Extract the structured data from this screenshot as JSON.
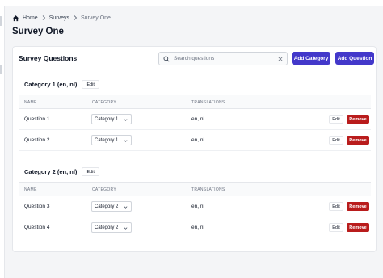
{
  "breadcrumb": {
    "home": "Home",
    "surveys": "Surveys",
    "current": "Survey One"
  },
  "page": {
    "title": "Survey One"
  },
  "card": {
    "title": "Survey Questions",
    "search_placeholder": "Search questions",
    "add_category_label": "Add Category",
    "add_question_label": "Add Question"
  },
  "columns": {
    "name": "NAME",
    "category": "CATEGORY",
    "translations": "TRANSLATIONS"
  },
  "actions": {
    "edit": "Edit",
    "remove": "Remove"
  },
  "categories": [
    {
      "title": "Category 1 (en, nl)",
      "edit_label": "Edit",
      "questions": [
        {
          "name": "Question 1",
          "category": "Category 1",
          "translations": "en, nl"
        },
        {
          "name": "Question 2",
          "category": "Category 1",
          "translations": "en, nl"
        }
      ]
    },
    {
      "title": "Category 2 (en, nl)",
      "edit_label": "Edit",
      "questions": [
        {
          "name": "Question 3",
          "category": "Category 2",
          "translations": "en, nl"
        },
        {
          "name": "Question 4",
          "category": "Category 2",
          "translations": "en, nl"
        }
      ]
    }
  ],
  "colors": {
    "primary": "#4338ca",
    "danger": "#b91c1c",
    "background": "#f4f5f7"
  }
}
